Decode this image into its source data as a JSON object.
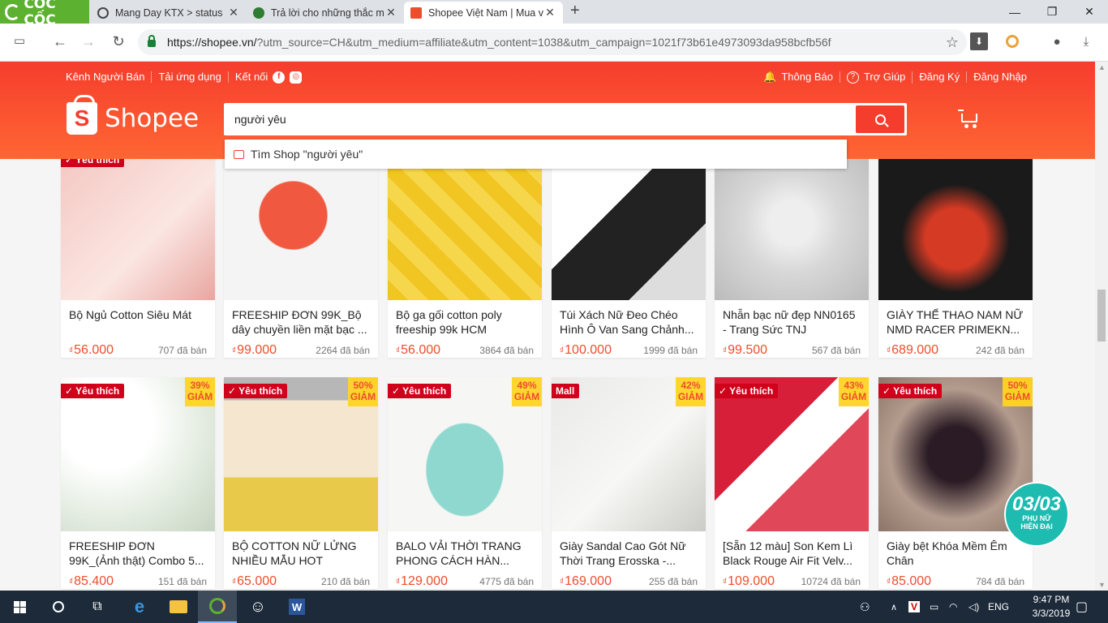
{
  "browser": {
    "brand": "CỐC CỐC",
    "tabs": [
      {
        "title": "Mang Day KTX > status",
        "icon": "page-icon"
      },
      {
        "title": "Trả lời cho những thắc mắ",
        "icon": "globe-icon"
      },
      {
        "title": "Shopee Việt Nam | Mua v",
        "icon": "shopee-icon"
      }
    ],
    "url_host": "https://shopee.vn/",
    "url_rest": "?utm_source=CH&utm_medium=affiliate&utm_content=1038&utm_campaign=1021f73b61e4973093da958bcfb56f"
  },
  "header": {
    "left_links": [
      "Kênh Người Bán",
      "Tải ứng dụng",
      "Kết nối"
    ],
    "right_links": [
      "Thông Báo",
      "Trợ Giúp",
      "Đăng Ký",
      "Đăng Nhập"
    ],
    "logo_text": "Shopee",
    "search_value": "người yêu",
    "suggestion": "Tìm Shop \"người yêu\""
  },
  "labels": {
    "favorite": "Yêu thích",
    "mall": "Mall",
    "discount": "GIẢM",
    "currency": "₫"
  },
  "products": [
    {
      "name": "Bộ Ngủ Cotton Siêu Mát",
      "price": "56.000",
      "sold": "707 đã bán",
      "fav": true,
      "disc": ""
    },
    {
      "name": "FREESHIP ĐƠN 99K_Bộ dây chuyền liền mặt bạc ...",
      "price": "99.000",
      "sold": "2264 đã bán",
      "fav": false,
      "disc": ""
    },
    {
      "name": "Bộ ga gối cotton poly freeship 99k HCM",
      "price": "56.000",
      "sold": "3864 đã bán",
      "fav": false,
      "disc": ""
    },
    {
      "name": "Túi Xách Nữ Đeo Chéo Hình Ô Van Sang Chảnh...",
      "price": "100.000",
      "sold": "1999 đã bán",
      "fav": false,
      "disc": ""
    },
    {
      "name": "Nhẫn bạc nữ đẹp NN0165 - Trang Sức TNJ",
      "price": "99.500",
      "sold": "567 đã bán",
      "fav": false,
      "disc": ""
    },
    {
      "name": "GIÀY THỂ THAO NAM NỮ NMD RACER PRIMEKN...",
      "price": "689.000",
      "sold": "242 đã bán",
      "fav": false,
      "disc": ""
    },
    {
      "name": "FREESHIP ĐƠN 99K_(Ảnh thật) Combo 5...",
      "price": "85.400",
      "sold": "151 đã bán",
      "fav": true,
      "disc": "39%"
    },
    {
      "name": "BỘ COTTON NỮ LỬNG NHIỀU MẪU HOT",
      "price": "65.000",
      "sold": "210 đã bán",
      "fav": true,
      "disc": "50%"
    },
    {
      "name": "BALO VẢI THỜI TRANG PHONG CÁCH HÀN...",
      "price": "129.000",
      "sold": "4775 đã bán",
      "fav": true,
      "disc": "49%"
    },
    {
      "name": "Giày Sandal Cao Gót Nữ Thời Trang Erosska -...",
      "price": "169.000",
      "sold": "255 đã bán",
      "fav": false,
      "mall": true,
      "disc": "42%"
    },
    {
      "name": "[Sẵn 12 màu] Son Kem Lì Black Rouge Air Fit Velv...",
      "price": "109.000",
      "sold": "10724 đã bán",
      "fav": true,
      "disc": "43%"
    },
    {
      "name": "Giày bệt Khóa Mềm Êm Chân",
      "price": "85.000",
      "sold": "784 đã bán",
      "fav": true,
      "disc": "50%"
    }
  ],
  "promo": {
    "date": "03/03",
    "line1": "PHỤ NỮ",
    "line2": "HIỆN ĐẠI"
  },
  "taskbar": {
    "lang": "ENG",
    "time": "9:47 PM",
    "date": "3/3/2019"
  },
  "colors": {
    "shopee": "#ee4d2d",
    "browser_brand": "#5cb130"
  }
}
